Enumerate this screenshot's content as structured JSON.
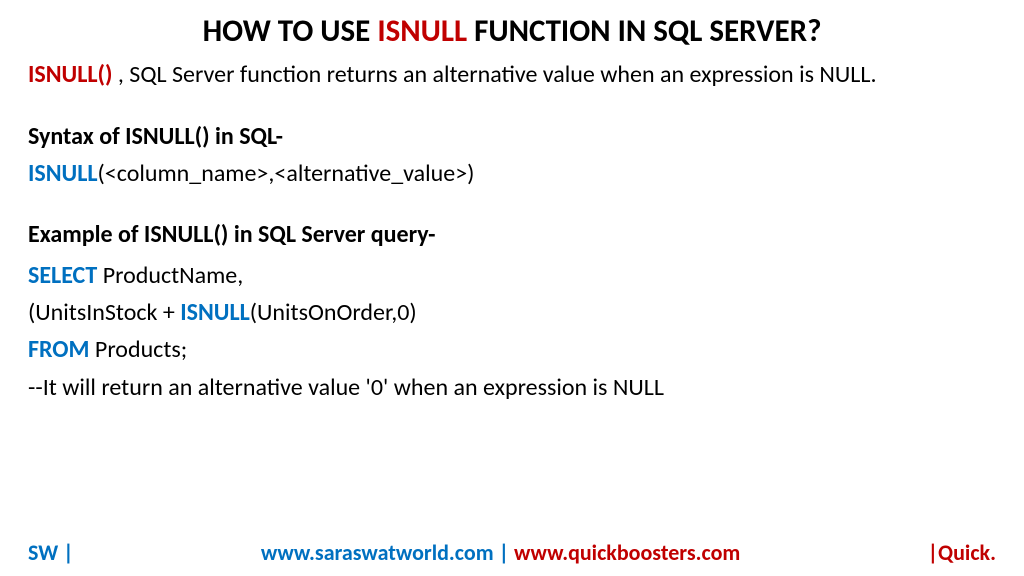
{
  "title": {
    "pre": "HOW TO USE ",
    "highlight": "ISNULL",
    "post": " FUNCTION IN SQL SERVER?"
  },
  "intro": {
    "func": "ISNULL()",
    "rest": " , SQL Server function returns an alternative value when an expression is NULL."
  },
  "syntax": {
    "heading": "Syntax of ISNULL() in SQL-",
    "keyword": "ISNULL",
    "args": "(<column_name>,<alternative_value>)"
  },
  "example": {
    "heading": "Example of ISNULL() in SQL Server query-",
    "line1_kw": "SELECT",
    "line1_rest": " ProductName,",
    "line2_pre": "(UnitsInStock + ",
    "line2_kw": "ISNULL",
    "line2_post": "(UnitsOnOrder,0)",
    "line3_kw": "FROM",
    "line3_rest": " Products;",
    "line4": "--It will return an alternative value '0' when an expression is NULL"
  },
  "footer": {
    "left": "SW |",
    "center_blue": "www.saraswatworld.com | ",
    "center_red": "www.quickboosters.com",
    "right": "|Quick."
  }
}
